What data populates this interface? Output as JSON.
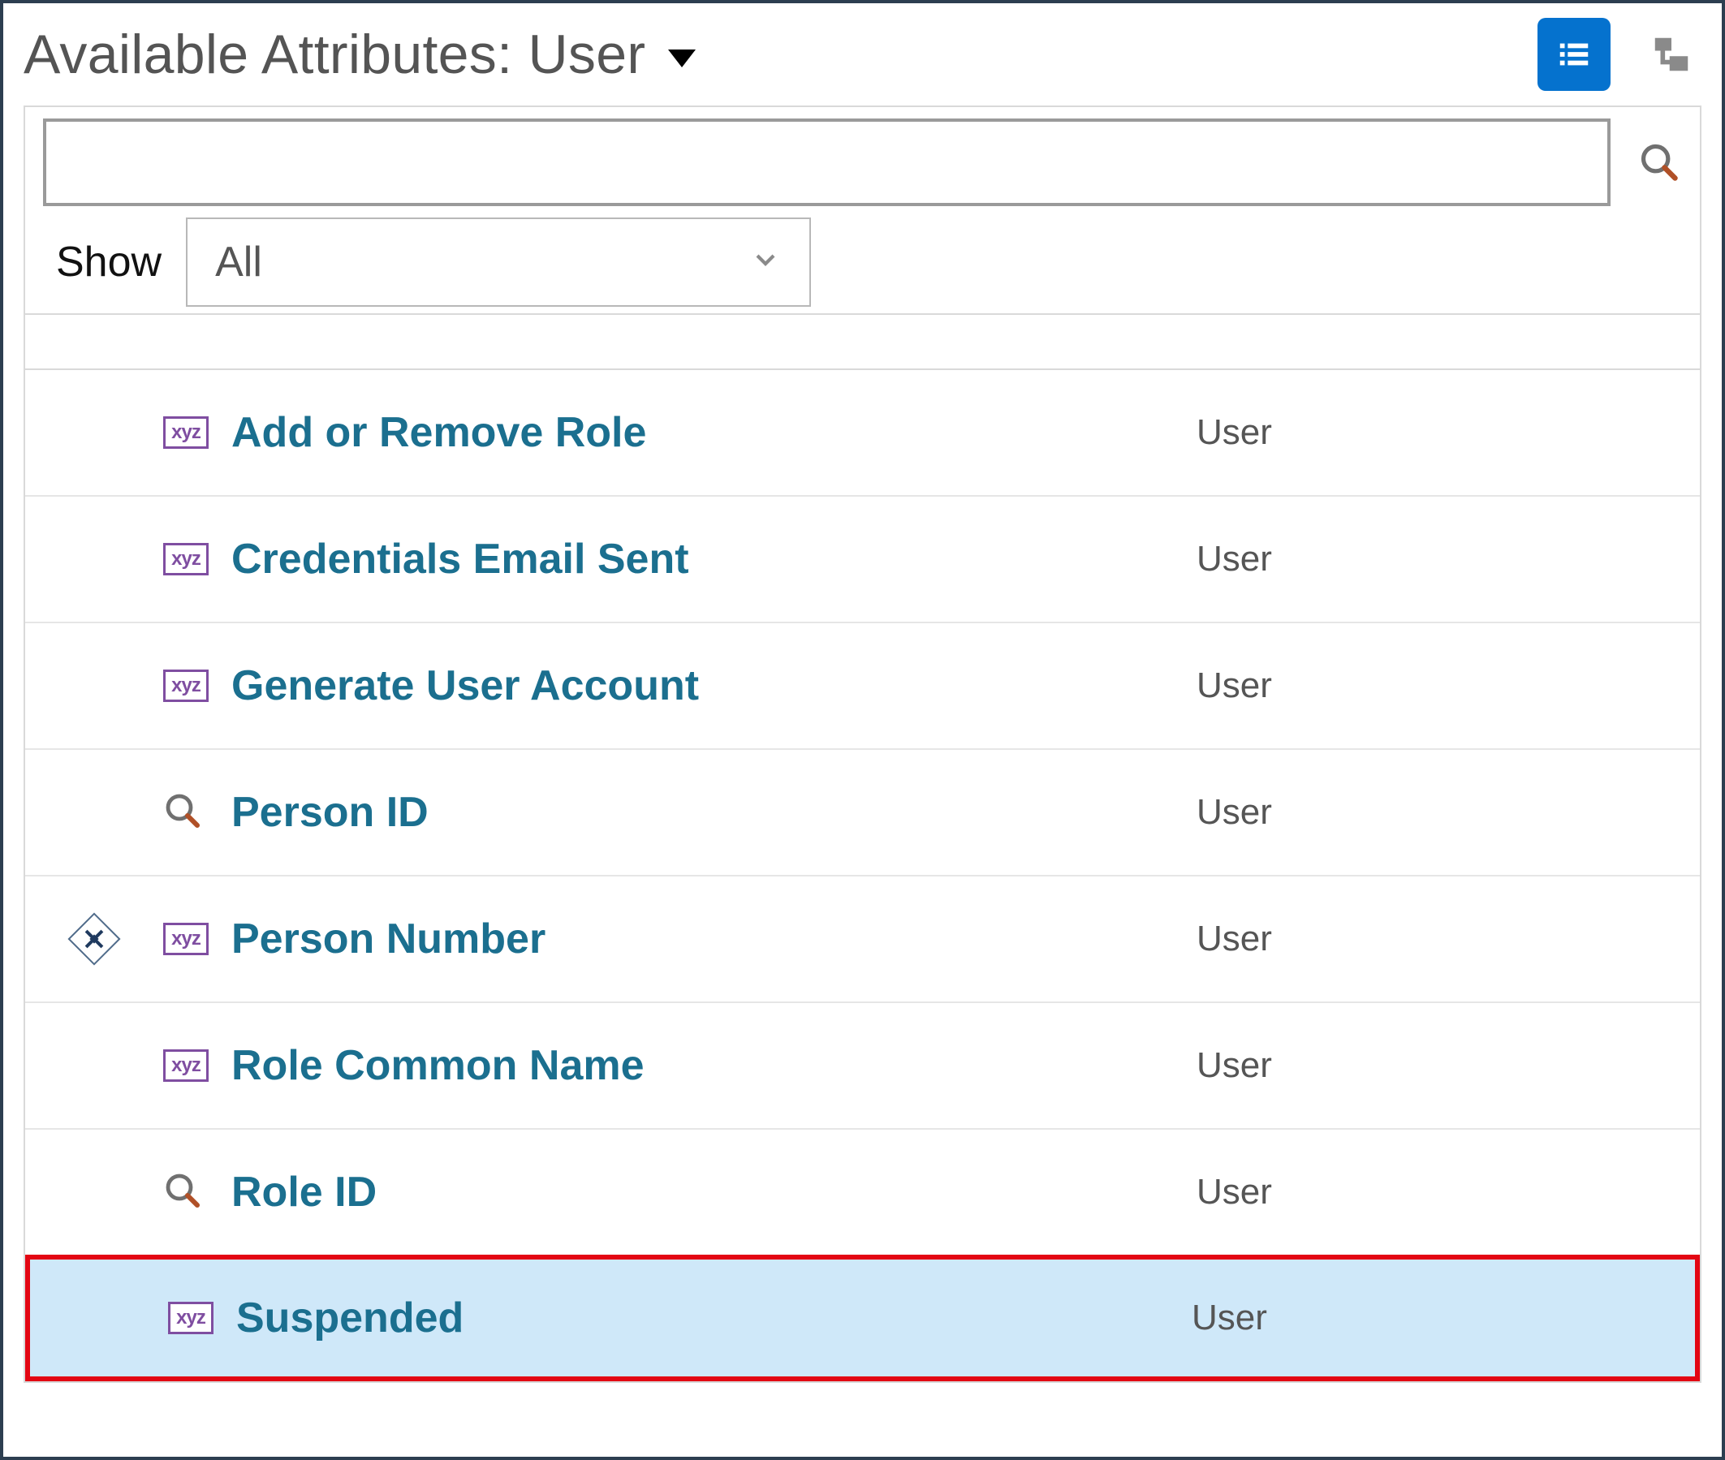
{
  "header": {
    "title": "Available Attributes: User"
  },
  "toolbar": {
    "search_value": "",
    "search_placeholder": "",
    "show_label": "Show",
    "show_value": "All"
  },
  "icons": {
    "xyz_badge_text": "xyz"
  },
  "attributes": [
    {
      "label": "Add or Remove Role",
      "category": "User",
      "icon": "xyz",
      "required": false,
      "highlighted": false
    },
    {
      "label": "Credentials Email Sent",
      "category": "User",
      "icon": "xyz",
      "required": false,
      "highlighted": false
    },
    {
      "label": "Generate User Account",
      "category": "User",
      "icon": "xyz",
      "required": false,
      "highlighted": false
    },
    {
      "label": "Person ID",
      "category": "User",
      "icon": "lookup",
      "required": false,
      "highlighted": false
    },
    {
      "label": "Person Number",
      "category": "User",
      "icon": "xyz",
      "required": true,
      "highlighted": false
    },
    {
      "label": "Role Common Name",
      "category": "User",
      "icon": "xyz",
      "required": false,
      "highlighted": false
    },
    {
      "label": "Role ID",
      "category": "User",
      "icon": "lookup",
      "required": false,
      "highlighted": false
    },
    {
      "label": "Suspended",
      "category": "User",
      "icon": "xyz",
      "required": false,
      "highlighted": true
    }
  ],
  "colors": {
    "link": "#1b6f8f",
    "primary": "#0572ce",
    "highlight_bg": "#cfe8f9",
    "highlight_border": "#e30613"
  }
}
